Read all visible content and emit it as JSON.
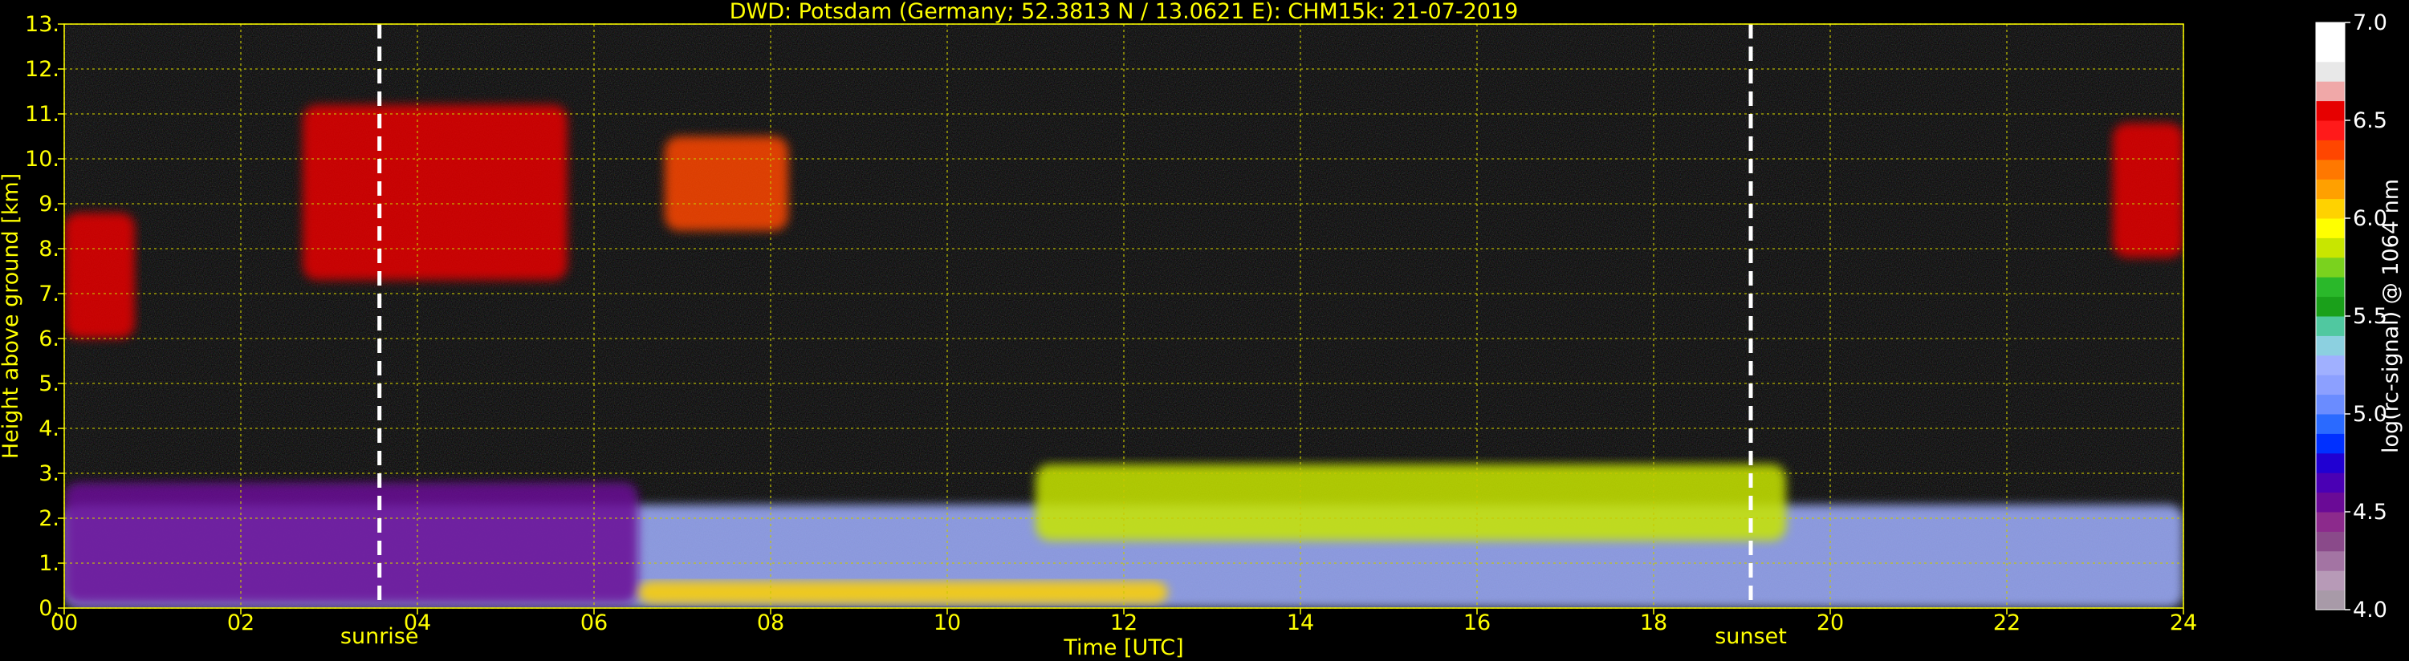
{
  "chart_data": {
    "type": "heatmap",
    "title": "DWD: Potsdam (Germany; 52.3813 N / 13.0621 E):    CHM15k: 21-07-2019",
    "xlabel": "Time [UTC]",
    "ylabel": "Height above ground [km]",
    "xlim": [
      0,
      24
    ],
    "ylim": [
      0,
      13
    ],
    "x_ticks": [
      {
        "value": 0,
        "label": "00"
      },
      {
        "value": 2,
        "label": "02"
      },
      {
        "value": 4,
        "label": "04"
      },
      {
        "value": 6,
        "label": "06"
      },
      {
        "value": 8,
        "label": "08"
      },
      {
        "value": 10,
        "label": "10"
      },
      {
        "value": 12,
        "label": "12"
      },
      {
        "value": 14,
        "label": "14"
      },
      {
        "value": 16,
        "label": "16"
      },
      {
        "value": 18,
        "label": "18"
      },
      {
        "value": 20,
        "label": "20"
      },
      {
        "value": 22,
        "label": "22"
      },
      {
        "value": 24,
        "label": "24"
      }
    ],
    "y_ticks": [
      {
        "value": 0,
        "label": "0."
      },
      {
        "value": 1,
        "label": "1."
      },
      {
        "value": 2,
        "label": "2."
      },
      {
        "value": 3,
        "label": "3."
      },
      {
        "value": 4,
        "label": "4."
      },
      {
        "value": 5,
        "label": "5."
      },
      {
        "value": 6,
        "label": "6."
      },
      {
        "value": 7,
        "label": "7."
      },
      {
        "value": 8,
        "label": "8."
      },
      {
        "value": 9,
        "label": "9."
      },
      {
        "value": 10,
        "label": "10."
      },
      {
        "value": 11,
        "label": "11."
      },
      {
        "value": 12,
        "label": "12."
      },
      {
        "value": 13,
        "label": "13."
      }
    ],
    "grid": true,
    "grid_color": "#c8c800",
    "background": "#000000",
    "markers": [
      {
        "name": "sunrise",
        "label": "sunrise",
        "x": 3.57
      },
      {
        "name": "sunset",
        "label": "sunset",
        "x": 19.1
      }
    ],
    "colorbar": {
      "label": "log(rc-signal) @ 1064 nm",
      "range": [
        4.0,
        7.0
      ],
      "ticks": [
        {
          "value": 4.0,
          "label": "4.0"
        },
        {
          "value": 4.5,
          "label": "4.5"
        },
        {
          "value": 5.0,
          "label": "5.0"
        },
        {
          "value": 5.5,
          "label": "5.5"
        },
        {
          "value": 6.0,
          "label": "6.0"
        },
        {
          "value": 6.5,
          "label": "6.5"
        },
        {
          "value": 7.0,
          "label": "7.0"
        }
      ],
      "colors": [
        "#a89aa8",
        "#b79ab7",
        "#a374a3",
        "#8a4a8a",
        "#8c2a8c",
        "#6a0a96",
        "#4a00b4",
        "#2000d2",
        "#0030ff",
        "#2a6aff",
        "#6a8cff",
        "#8ca0ff",
        "#a0b0ff",
        "#8cd0e0",
        "#50c8a0",
        "#1aa01a",
        "#2ab82a",
        "#7ad21e",
        "#c8e600",
        "#ffff00",
        "#ffd200",
        "#ffa000",
        "#ff7800",
        "#ff4600",
        "#ff1a1a",
        "#e60000",
        "#f0a8a8",
        "#e8e8e8",
        "#ffffff",
        "#ffffff"
      ]
    },
    "features": [
      {
        "name": "boundary-layer-aerosol",
        "t_start": 0,
        "t_end": 24,
        "h_base": 0.0,
        "h_top": 2.3,
        "level": 5.3
      },
      {
        "name": "residual-layer",
        "t_start": 0,
        "t_end": 6.5,
        "h_base": 0.1,
        "h_top": 2.8,
        "level": 4.6
      },
      {
        "name": "surface-peak",
        "t_start": 6.5,
        "t_end": 12.5,
        "h_base": 0.1,
        "h_top": 0.6,
        "level": 6.0
      },
      {
        "name": "convective-clouds",
        "t_start": 11.0,
        "t_end": 19.5,
        "h_base": 1.5,
        "h_top": 3.2,
        "level": 5.8
      },
      {
        "name": "cirrus-early",
        "t_start": 0,
        "t_end": 0.8,
        "h_base": 6.0,
        "h_top": 8.8,
        "level": 6.5
      },
      {
        "name": "cirrus-morning",
        "t_start": 2.7,
        "t_end": 5.7,
        "h_base": 7.3,
        "h_top": 11.2,
        "level": 6.5
      },
      {
        "name": "cirrus-midday",
        "t_start": 6.8,
        "t_end": 8.2,
        "h_base": 8.4,
        "h_top": 10.5,
        "level": 6.3
      },
      {
        "name": "cirrus-late",
        "t_start": 23.2,
        "t_end": 24,
        "h_base": 7.8,
        "h_top": 10.8,
        "level": 6.5
      }
    ]
  }
}
